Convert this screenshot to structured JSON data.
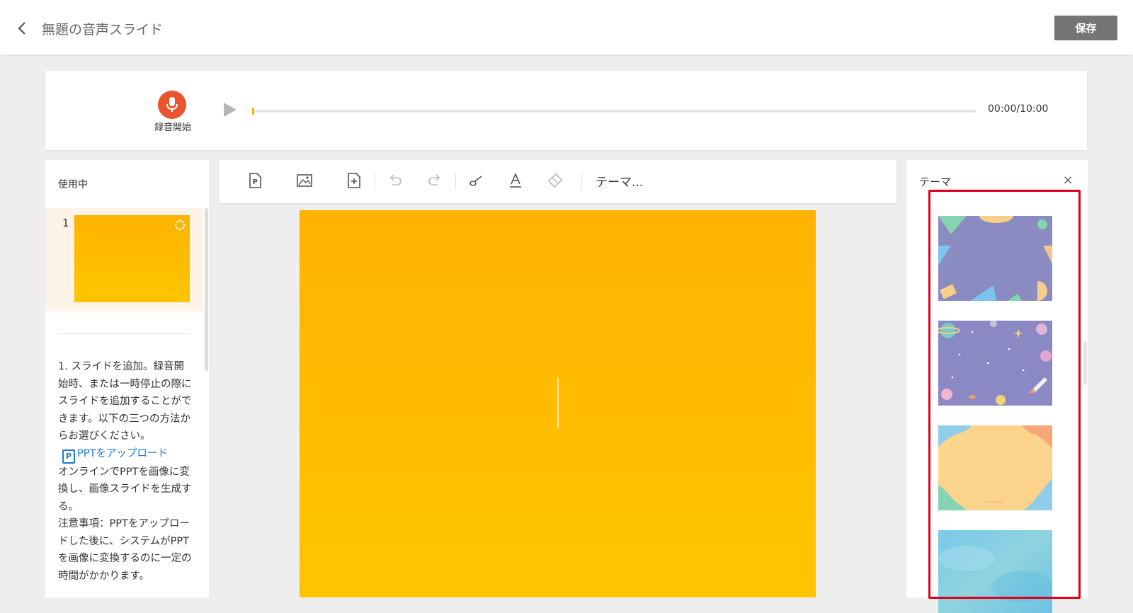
{
  "header": {
    "back_icon": "chevron-left-icon",
    "title": "無題の音声スライド",
    "save_label": "保存"
  },
  "recorder": {
    "record_label": "録音開始",
    "mic_color": "#e9542e",
    "time": "00:00/10:00",
    "progress": 0
  },
  "slides_panel": {
    "heading": "使用中",
    "slides": [
      {
        "number": "1"
      }
    ]
  },
  "help": {
    "intro": "1. スライドを追加。録音開始時、または一時停止の際にスライドを追加することができます。以下の三つの方法からお選びください。",
    "ppt_icon_letter": "P",
    "ppt_link": "PPTをアップロード",
    "description": "オンラインでPPTを画像に変換し、画像スライドを生成する。",
    "note": "注意事項：PPTをアップロードした後に、システムがPPTを画像に変換するのに一定の時間がかかります。"
  },
  "toolbar": {
    "items": [
      "ppt-upload-icon",
      "image-icon",
      "add-slide-icon",
      "undo-icon",
      "redo-icon",
      "brush-icon",
      "text-color-icon",
      "eraser-icon"
    ],
    "theme_label": "テーマ..."
  },
  "theme_panel": {
    "title": "テーマ",
    "close": "×",
    "themes": [
      "geometric-purple",
      "space-purple",
      "wavy-orange",
      "watercolor-blue"
    ]
  },
  "colors": {
    "accent": "#ffb400",
    "slide_bg": "#ffb300",
    "highlight": "#e0001a",
    "link": "#1b7ad4",
    "save_button": "#757575"
  }
}
